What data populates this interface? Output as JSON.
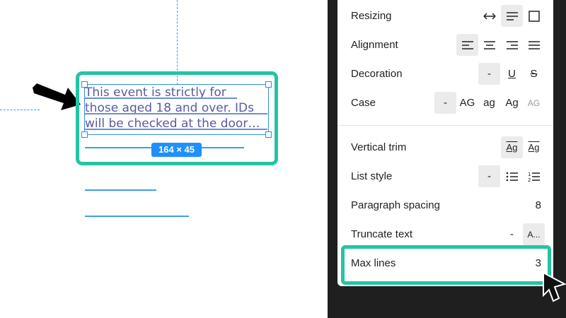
{
  "canvas": {
    "text_lines": [
      "This event is strictly for",
      "those aged 18 and over. IDs",
      "will be checked at the door…"
    ],
    "size_badge": "164 × 45"
  },
  "panel": {
    "resizing": {
      "label": "Resizing"
    },
    "alignment": {
      "label": "Alignment"
    },
    "decoration": {
      "label": "Decoration",
      "none": "-",
      "underline": "U",
      "strike": "S"
    },
    "case": {
      "label": "Case",
      "none": "-",
      "upper": "AG",
      "lower": "ag",
      "title": "Ag",
      "small_caps": "AG"
    },
    "vertical_trim": {
      "label": "Vertical trim",
      "opt1": "Ag",
      "opt2": "Ag"
    },
    "list_style": {
      "label": "List style",
      "none": "-"
    },
    "paragraph_spacing": {
      "label": "Paragraph spacing",
      "value": "8"
    },
    "truncate_text": {
      "label": "Truncate text",
      "none": "-",
      "truncate": "A..."
    },
    "max_lines": {
      "label": "Max lines",
      "value": "3"
    }
  },
  "colors": {
    "highlight": "#24c4a2",
    "selection": "#2f8ee8",
    "badge": "#1e90ff",
    "dark_background": "#1f1f1f"
  }
}
